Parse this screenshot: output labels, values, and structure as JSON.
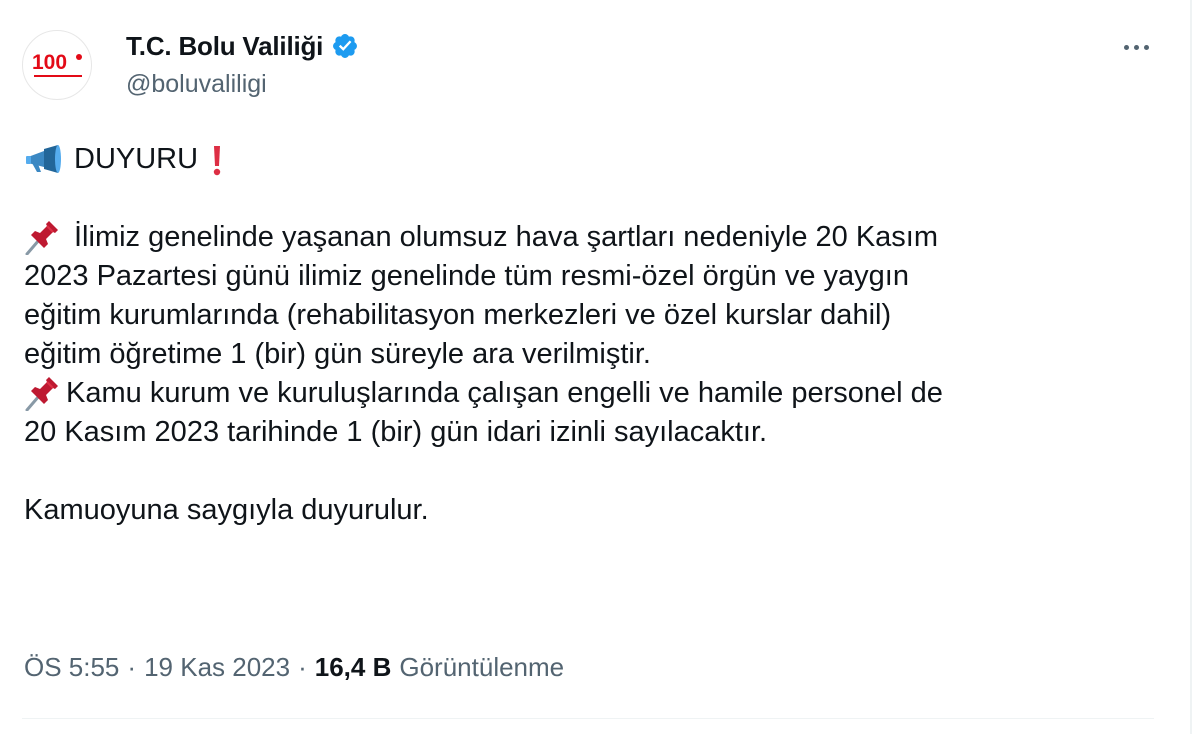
{
  "author": {
    "display_name": "T.C. Bolu Valiliği",
    "handle": "@boluvaliligi",
    "avatar_text": "100",
    "verified": true,
    "verified_color": "#1d9bf0"
  },
  "tweet": {
    "lines": [
      {
        "icon": "megaphone-icon",
        "text": "DUYURU",
        "trailing_icon": "exclamation-icon"
      },
      {
        "blank": true
      },
      {
        "icon": "pushpin-icon",
        "text": "İlimiz genelinde yaşanan olumsuz hava şartları nedeniyle 20 Kasım"
      },
      {
        "text": "2023 Pazartesi günü ilimiz genelinde tüm resmi-özel örgün ve yaygın"
      },
      {
        "text": "eğitim kurumlarında (rehabilitasyon merkezleri ve özel kurslar dahil)"
      },
      {
        "text": "eğitim öğretime 1 (bir) gün süreyle ara verilmiştir."
      },
      {
        "icon": "pushpin-icon",
        "text": "Kamu kurum ve kuruluşlarında çalışan engelli ve hamile personel de"
      },
      {
        "text": "20 Kasım 2023 tarihinde 1 (bir) gün idari izinli sayılacaktır."
      },
      {
        "blank": true
      },
      {
        "text": "Kamuoyuna saygıyla duyurulur."
      }
    ]
  },
  "meta": {
    "time": "ÖS 5:55",
    "separator": "·",
    "date": "19 Kas 2023",
    "views_count": "16,4 B",
    "views_label": "Görüntülenme"
  },
  "colors": {
    "text": "#0f1419",
    "secondary": "#536471",
    "divider": "#eff3f4",
    "avatar_red": "#e30a17"
  }
}
